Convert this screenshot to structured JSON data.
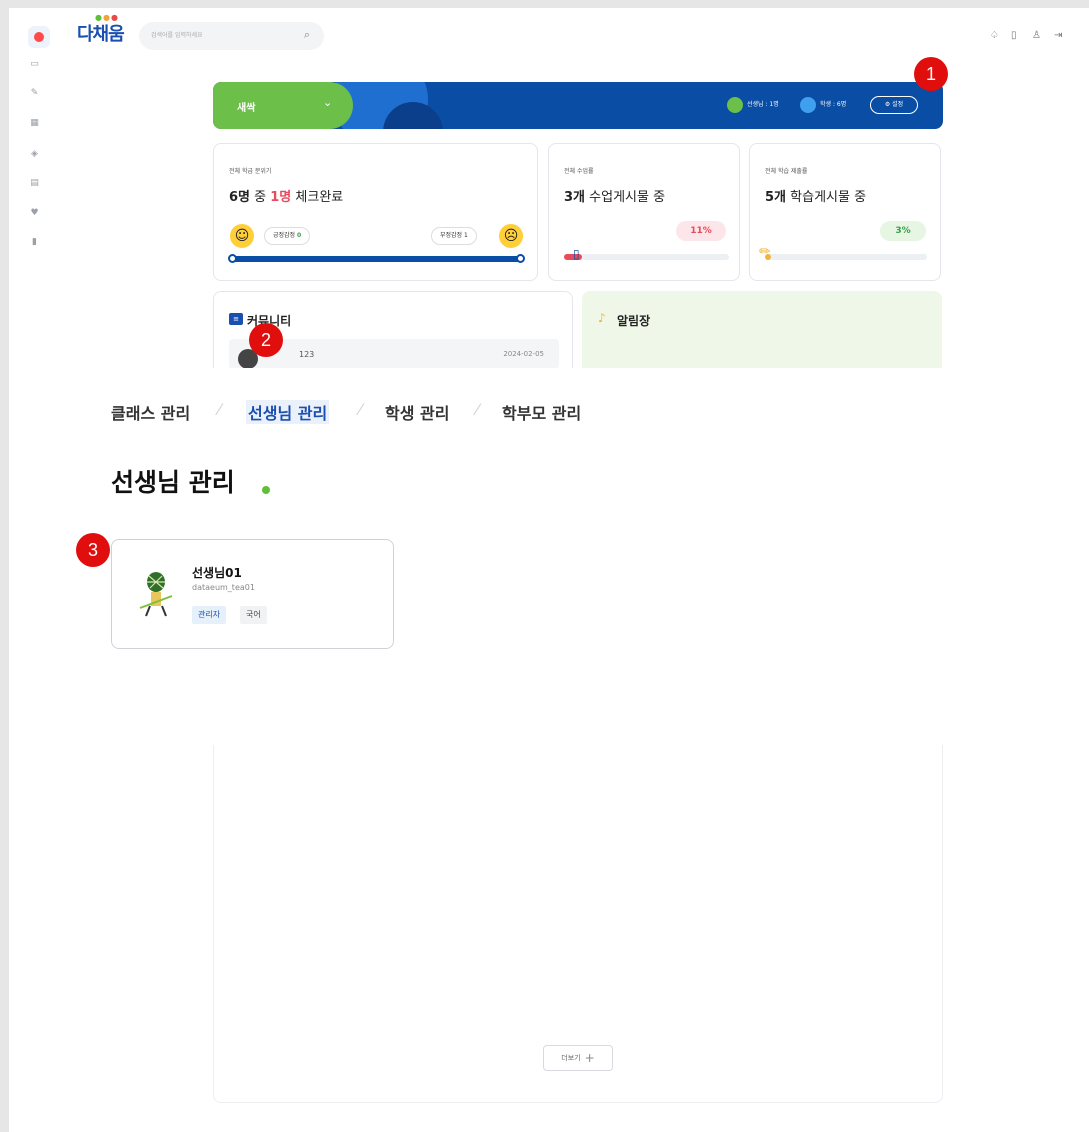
{
  "app": {
    "logo": "다채움",
    "search_placeholder": "검색어를 입력하세요"
  },
  "banner": {
    "class_name": "새싹",
    "teacher_count": "선생님 : 1명",
    "student_count": "학생 : 6명",
    "settings_label": "설정"
  },
  "cards": {
    "mood": {
      "label": "전체 학급 분위기",
      "total": "6명",
      "mid": " 중 ",
      "checked": "1명",
      "suffix": " 체크완료",
      "positive_label": "긍정감정",
      "positive_count": "0",
      "negative_label": "부정감정 1"
    },
    "lesson": {
      "label": "전체 수업률",
      "count": "3개",
      "suffix": " 수업게시물 중",
      "percent": "11%",
      "progress": 0.11
    },
    "study": {
      "label": "전체 학습 제출률",
      "count": "5개",
      "suffix": " 학습게시물 중",
      "percent": "3%",
      "progress": 0.03
    },
    "community": {
      "title": "커뮤니티",
      "item_text": "123",
      "item_date": "2024-02-05"
    },
    "notice": {
      "title": "알림장"
    }
  },
  "breadcrumb": [
    "클래스 관리",
    "선생님 관리",
    "학생 관리",
    "학부모 관리"
  ],
  "page_title": "선생님 관리",
  "teacher": {
    "name": "선생님01",
    "id": "dataeum_tea01",
    "role": "관리자",
    "subject": "국어"
  },
  "more_label": "더보기",
  "markers": [
    "1",
    "2",
    "3"
  ],
  "colors": {
    "brand_blue": "#0a4da5",
    "brand_green": "#6cc04a",
    "marker_red": "#e10e0e"
  }
}
